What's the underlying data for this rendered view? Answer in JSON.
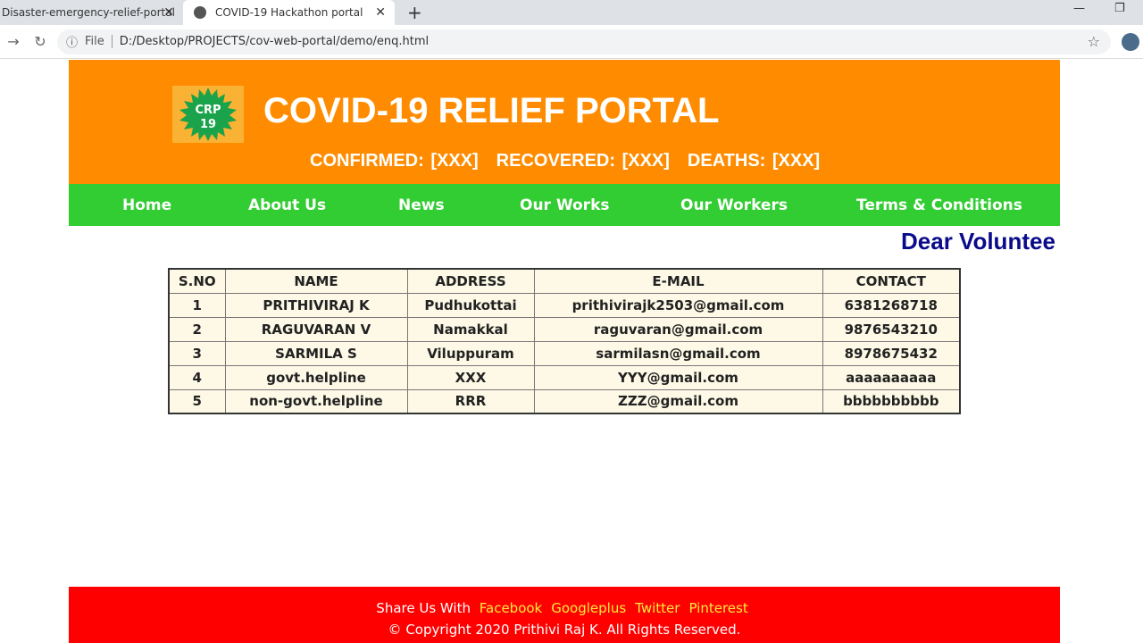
{
  "browser": {
    "tabs": [
      {
        "title": "Disaster-emergency-relief-portal"
      },
      {
        "title": "COVID-19 Hackathon portal"
      }
    ],
    "url_scheme": "File",
    "url": "D:/Desktop/PROJECTS/cov-web-portal/demo/enq.html"
  },
  "header": {
    "logo_text": "CRP 19",
    "title": "COVID-19 RELIEF PORTAL",
    "stats": [
      "CONFIRMED: [XXX]",
      "RECOVERED: [XXX]",
      "DEATHS: [XXX]"
    ]
  },
  "menu": [
    "Home",
    "About Us",
    "News",
    "Our Works",
    "Our Workers",
    "Terms & Conditions"
  ],
  "marquee": "Dear Voluntee",
  "table": {
    "headers": [
      "S.NO",
      "NAME",
      "ADDRESS",
      "E-MAIL",
      "CONTACT"
    ],
    "rows": [
      [
        "1",
        "PRITHIVIRAJ K",
        "Pudhukottai",
        "prithivirajk2503@gmail.com",
        "6381268718"
      ],
      [
        "2",
        "RAGUVARAN V",
        "Namakkal",
        "raguvaran@gmail.com",
        "9876543210"
      ],
      [
        "3",
        "SARMILA S",
        "Viluppuram",
        "sarmilasn@gmail.com",
        "8978675432"
      ],
      [
        "4",
        "govt.helpline",
        "XXX",
        "YYY@gmail.com",
        "aaaaaaaaaa"
      ],
      [
        "5",
        "non-govt.helpline",
        "RRR",
        "ZZZ@gmail.com",
        "bbbbbbbbbb"
      ]
    ]
  },
  "footer": {
    "share_label": "Share Us With",
    "links": [
      "Facebook",
      "Googleplus",
      "Twitter",
      "Pinterest"
    ],
    "copyright": "© Copyright 2020 Prithivi Raj K. All Rights Reserved."
  }
}
